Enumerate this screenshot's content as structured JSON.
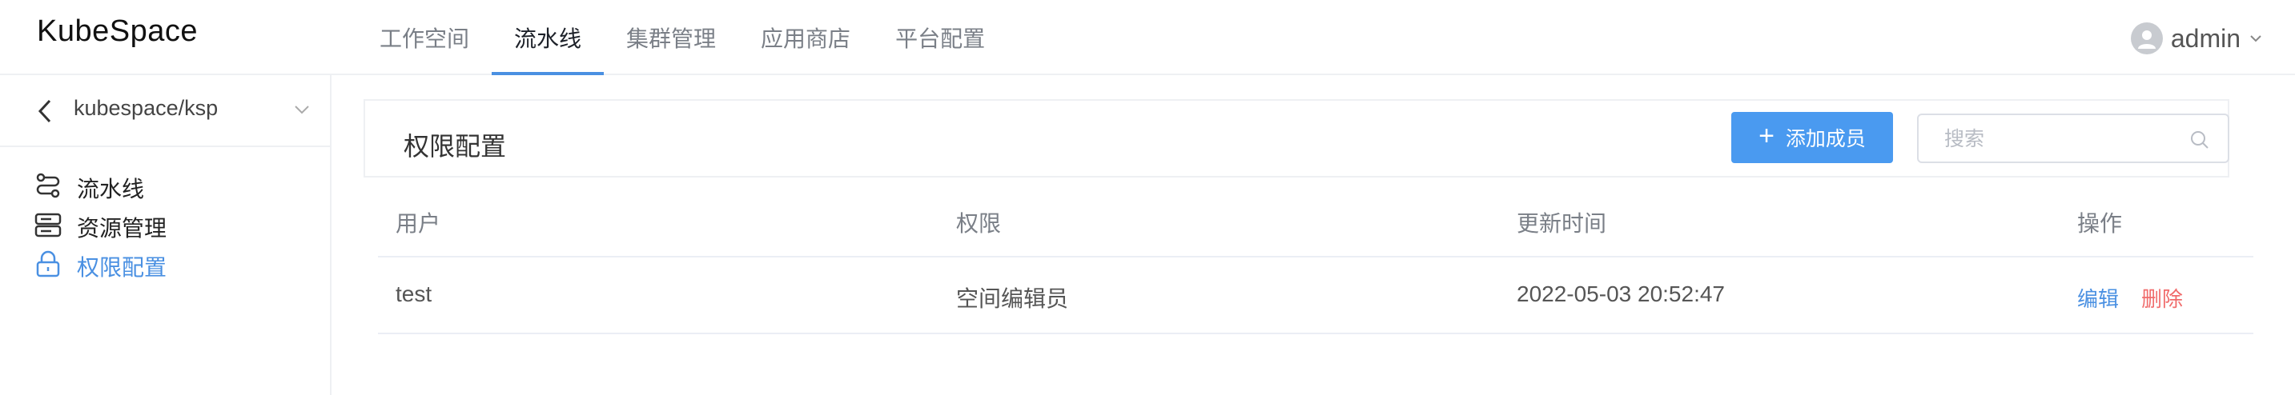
{
  "app": {
    "logo": "KubeSpace"
  },
  "nav": {
    "items": [
      {
        "label": "工作空间"
      },
      {
        "label": "流水线",
        "active": true
      },
      {
        "label": "集群管理"
      },
      {
        "label": "应用商店"
      },
      {
        "label": "平台配置"
      }
    ]
  },
  "user": {
    "name": "admin"
  },
  "sidebar": {
    "workspace": "kubespace/ksp",
    "items": [
      {
        "label": "流水线",
        "icon": "pipeline-icon"
      },
      {
        "label": "资源管理",
        "icon": "server-icon"
      },
      {
        "label": "权限配置",
        "icon": "lock-icon",
        "active": true
      }
    ]
  },
  "panel": {
    "title": "权限配置",
    "add_label": "添加成员",
    "search_placeholder": "搜索"
  },
  "table": {
    "columns": [
      "用户",
      "权限",
      "更新时间",
      "操作"
    ],
    "rows": [
      {
        "user": "test",
        "role": "空间编辑员",
        "updated": "2022-05-03 20:52:47",
        "edit": "编辑",
        "delete": "删除"
      }
    ]
  },
  "colors": {
    "accent": "#4a90e2",
    "danger": "#f06c6c"
  }
}
